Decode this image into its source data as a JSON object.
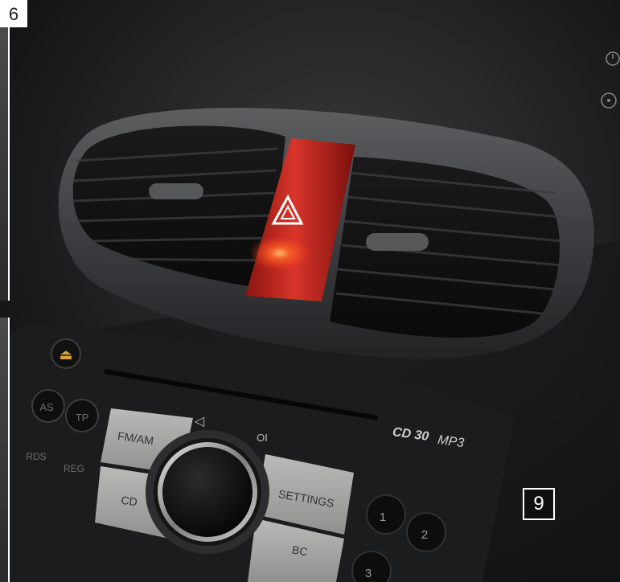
{
  "page_label": "6",
  "figure_label": "9",
  "hazard_icon": "warning-triangle-icon",
  "radio": {
    "model": "CD 30",
    "model_suffix": "MP3",
    "buttons": {
      "fm_am": "FM/AM",
      "cd": "CD",
      "settings": "SETTINGS",
      "bc": "BC",
      "as": "AS",
      "tp": "TP",
      "rds": "RDS",
      "reg": "REG"
    },
    "presets": [
      "1",
      "2",
      "3"
    ],
    "symbols": {
      "back": "◁",
      "power": "OI",
      "eject": "⏏"
    }
  }
}
